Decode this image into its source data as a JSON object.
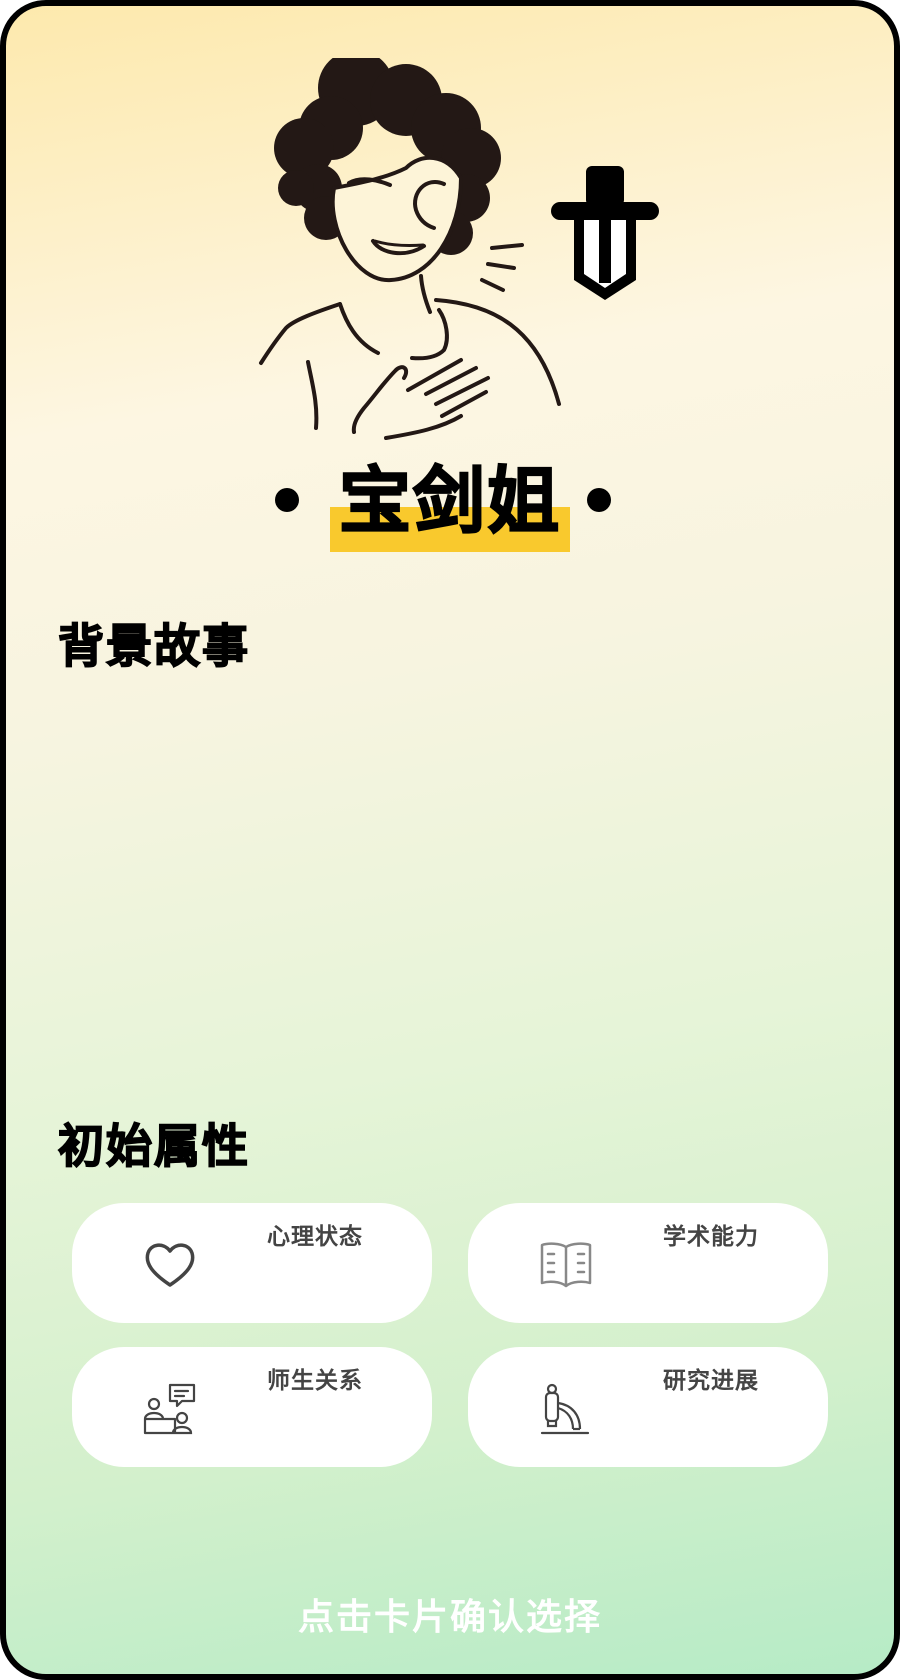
{
  "character": {
    "name": "宝剑姐"
  },
  "sections": {
    "story_title": "背景故事",
    "story_body": "",
    "attributes_title": "初始属性"
  },
  "attributes": [
    {
      "label": "心理状态",
      "icon": "heart-icon"
    },
    {
      "label": "学术能力",
      "icon": "book-icon"
    },
    {
      "label": "师生关系",
      "icon": "teacher-student-icon"
    },
    {
      "label": "研究进展",
      "icon": "microscope-icon"
    }
  ],
  "footer": {
    "hint": "点击卡片确认选择"
  },
  "colors": {
    "highlight": "#f9c92d",
    "border": "#000000",
    "card_bg": "#ffffff",
    "gradient_top": "#fde9ad",
    "gradient_bottom": "#b6ebc6"
  }
}
